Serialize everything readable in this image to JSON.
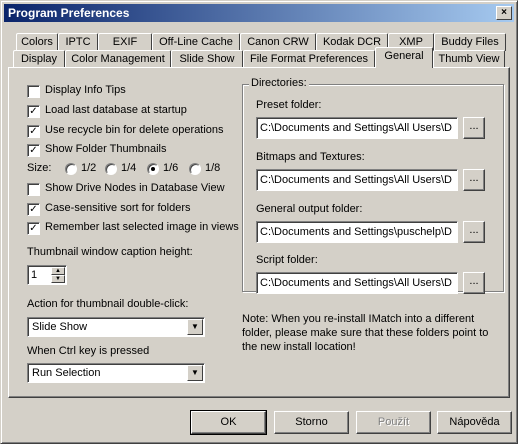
{
  "window": {
    "title": "Program Preferences",
    "close_glyph": "×"
  },
  "tabs": {
    "row1": [
      {
        "label": "Colors"
      },
      {
        "label": "IPTC"
      },
      {
        "label": "EXIF"
      },
      {
        "label": "Off-Line Cache"
      },
      {
        "label": "Canon CRW"
      },
      {
        "label": "Kodak DCR"
      },
      {
        "label": "XMP"
      },
      {
        "label": "Buddy Files"
      }
    ],
    "row2": [
      {
        "label": "Display"
      },
      {
        "label": "Color Management"
      },
      {
        "label": "Slide Show"
      },
      {
        "label": "File Format Preferences"
      },
      {
        "label": "General"
      },
      {
        "label": "Thumb View"
      }
    ],
    "active": "General"
  },
  "general": {
    "display_info_tips": {
      "label": "Display Info Tips",
      "checked": false
    },
    "load_last_db": {
      "label": "Load last database at startup",
      "checked": true
    },
    "recycle_bin": {
      "label": "Use recycle bin for delete operations",
      "checked": true
    },
    "folder_thumbs": {
      "label": "Show Folder Thumbnails",
      "checked": true
    },
    "size_label": "Size:",
    "sizes": [
      {
        "label": "1/2",
        "selected": false
      },
      {
        "label": "1/4",
        "selected": false
      },
      {
        "label": "1/6",
        "selected": true
      },
      {
        "label": "1/8",
        "selected": false
      }
    ],
    "drive_nodes": {
      "label": "Show Drive Nodes in Database View",
      "checked": false
    },
    "case_sensitive": {
      "label": "Case-sensitive sort for folders",
      "checked": true
    },
    "remember_last": {
      "label": "Remember last selected image in views",
      "checked": true
    },
    "caption_height_label": "Thumbnail window caption height:",
    "caption_height_value": "1",
    "double_click_label": "Action for thumbnail double-click:",
    "double_click_value": "Slide Show",
    "ctrl_key_label": "When Ctrl key is pressed",
    "ctrl_key_value": "Run Selection",
    "check_glyph": "✓",
    "dropdown_glyph": "▼",
    "spin_up_glyph": "▲",
    "spin_down_glyph": "▼"
  },
  "directories": {
    "legend": "Directories:",
    "browse_label": "...",
    "preset": {
      "label": "Preset folder:",
      "value": "C:\\Documents and Settings\\All Users\\D"
    },
    "bitmaps": {
      "label": "Bitmaps and Textures:",
      "value": "C:\\Documents and Settings\\All Users\\D"
    },
    "output": {
      "label": "General output folder:",
      "value": "C:\\Documents and Settings\\puschelp\\D"
    },
    "script": {
      "label": "Script folder:",
      "value": "C:\\Documents and Settings\\All Users\\D"
    },
    "note": "Note: When you re-install IMatch into a different folder, please make sure that these folders point to the new install location!"
  },
  "buttons": {
    "ok": "OK",
    "cancel": "Storno",
    "apply": "Použít",
    "help": "Nápověda"
  }
}
